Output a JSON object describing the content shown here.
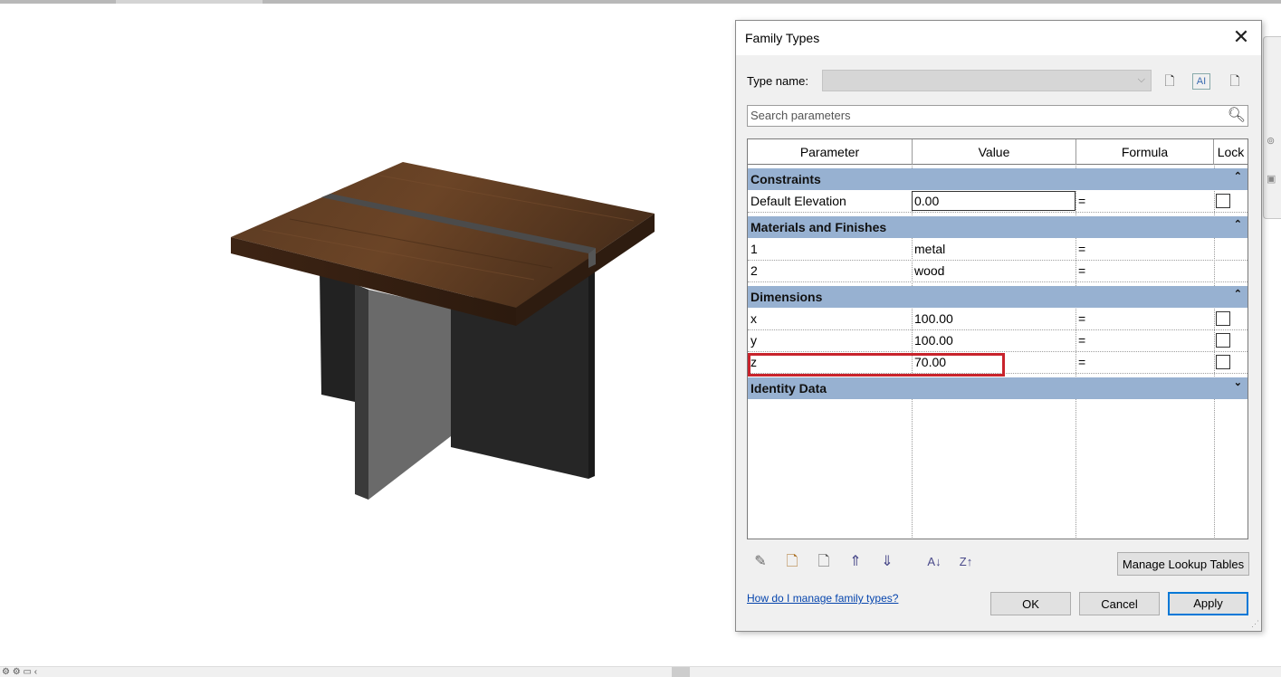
{
  "dialog": {
    "title": "Family Types",
    "type_name_label": "Type name:",
    "type_name_value": "",
    "search_placeholder": "Search parameters",
    "columns": {
      "parameter": "Parameter",
      "value": "Value",
      "formula": "Formula",
      "lock": "Lock"
    },
    "groups": {
      "constraints": {
        "label": "Constraints",
        "rows": [
          {
            "parameter": "Default Elevation",
            "value": "0.00",
            "formula": "=",
            "lock": false
          }
        ]
      },
      "materials": {
        "label": "Materials and Finishes",
        "rows": [
          {
            "parameter": "1",
            "value": "metal",
            "formula": "="
          },
          {
            "parameter": "2",
            "value": "wood",
            "formula": "="
          }
        ]
      },
      "dimensions": {
        "label": "Dimensions",
        "rows": [
          {
            "parameter": "x",
            "value": "100.00",
            "formula": "=",
            "lock": false
          },
          {
            "parameter": "y",
            "value": "100.00",
            "formula": "=",
            "lock": false
          },
          {
            "parameter": "z",
            "value": "70.00",
            "formula": "=",
            "lock": false
          }
        ]
      },
      "identity": {
        "label": "Identity Data"
      }
    },
    "manage_lookup_label": "Manage Lookup Tables",
    "help_link": "How do I manage family types?",
    "ok_label": "OK",
    "cancel_label": "Cancel",
    "apply_label": "Apply"
  },
  "colors": {
    "group_header": "#97b1d1",
    "highlight": "#c8232c",
    "link": "#0645ad",
    "table_top_dark": "#4a2d1a",
    "table_base": "#2a2a2a"
  }
}
